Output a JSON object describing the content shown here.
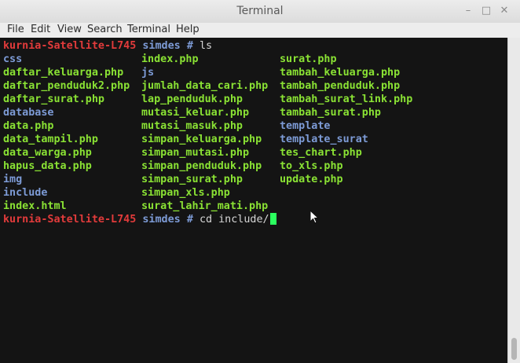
{
  "window": {
    "title": "Terminal",
    "controls": {
      "minimize": "–",
      "maximize": "□",
      "close": "✕"
    }
  },
  "menu": [
    "File",
    "Edit",
    "View",
    "Search",
    "Terminal",
    "Help"
  ],
  "prompt": {
    "host": "kurnia-Satellite-L745",
    "cwd": "simdes",
    "symbol": "#"
  },
  "commands": {
    "first": "ls",
    "second": "cd include/"
  },
  "listing": {
    "col1": [
      {
        "name": "css",
        "kind": "dir"
      },
      {
        "name": "daftar_keluarga.php",
        "kind": "file"
      },
      {
        "name": "daftar_penduduk2.php",
        "kind": "file"
      },
      {
        "name": "daftar_surat.php",
        "kind": "file"
      },
      {
        "name": "database",
        "kind": "dir"
      },
      {
        "name": "data.php",
        "kind": "file"
      },
      {
        "name": "data_tampil.php",
        "kind": "file"
      },
      {
        "name": "data_warga.php",
        "kind": "file"
      },
      {
        "name": "hapus_data.php",
        "kind": "file"
      },
      {
        "name": "img",
        "kind": "dir"
      },
      {
        "name": "include",
        "kind": "dir"
      },
      {
        "name": "index.html",
        "kind": "file"
      }
    ],
    "col2": [
      {
        "name": "index.php",
        "kind": "file"
      },
      {
        "name": "js",
        "kind": "dir"
      },
      {
        "name": "jumlah_data_cari.php",
        "kind": "file"
      },
      {
        "name": "lap_penduduk.php",
        "kind": "file"
      },
      {
        "name": "mutasi_keluar.php",
        "kind": "file"
      },
      {
        "name": "mutasi_masuk.php",
        "kind": "file"
      },
      {
        "name": "simpan_keluarga.php",
        "kind": "file"
      },
      {
        "name": "simpan_mutasi.php",
        "kind": "file"
      },
      {
        "name": "simpan_penduduk.php",
        "kind": "file"
      },
      {
        "name": "simpan_surat.php",
        "kind": "file"
      },
      {
        "name": "simpan_xls.php",
        "kind": "file"
      },
      {
        "name": "surat_lahir_mati.php",
        "kind": "file"
      }
    ],
    "col3": [
      {
        "name": "surat.php",
        "kind": "file"
      },
      {
        "name": "tambah_keluarga.php",
        "kind": "file"
      },
      {
        "name": "tambah_penduduk.php",
        "kind": "file"
      },
      {
        "name": "tambah_surat_link.php",
        "kind": "file"
      },
      {
        "name": "tambah_surat.php",
        "kind": "file"
      },
      {
        "name": "template",
        "kind": "dir"
      },
      {
        "name": "template_surat",
        "kind": "dir"
      },
      {
        "name": "tes_chart.php",
        "kind": "file"
      },
      {
        "name": "to_xls.php",
        "kind": "file"
      },
      {
        "name": "update.php",
        "kind": "file"
      }
    ]
  }
}
